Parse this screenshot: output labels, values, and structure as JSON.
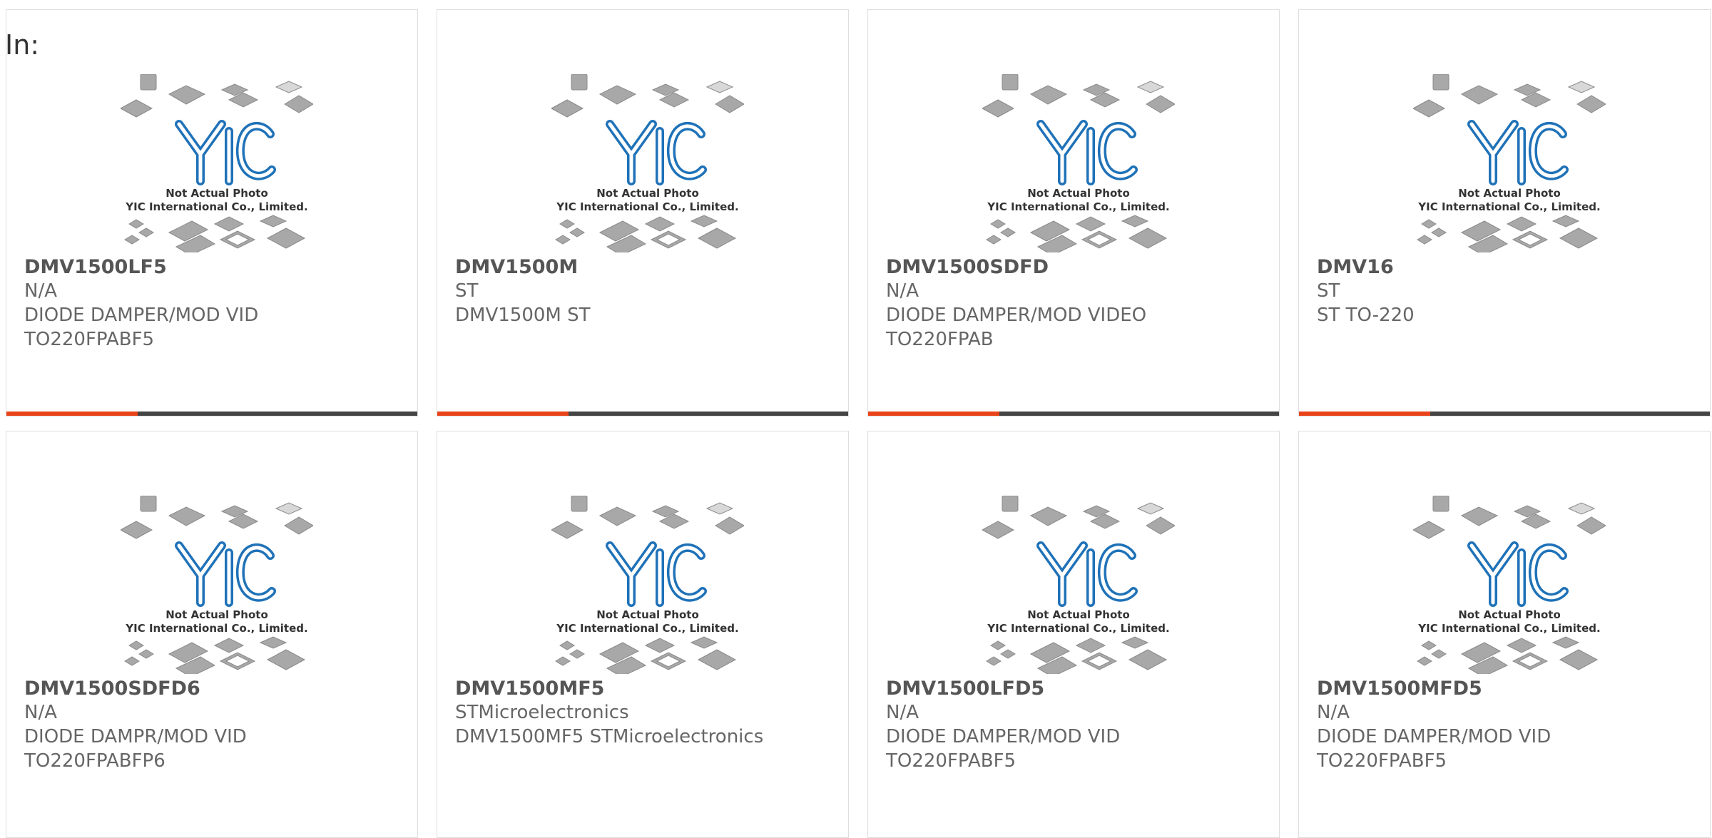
{
  "search": {
    "label": "In:"
  },
  "placeholder_image": {
    "caption_line1": "Not Actual Photo",
    "caption_line2": "YIC International Co., Limited.",
    "logo_text": "YIC"
  },
  "colors": {
    "accent": "#e8431a",
    "bar": "#444444",
    "logo_blue": "#1f72b8",
    "chip_gray": "#a8a8a8"
  },
  "products": [
    {
      "part": "DMV1500LF5",
      "mfr": "N/A",
      "desc1": "DIODE DAMPER/MOD VID",
      "desc2": "TO220FPABF5"
    },
    {
      "part": "DMV1500M",
      "mfr": "ST",
      "desc1": "DMV1500M ST",
      "desc2": ""
    },
    {
      "part": "DMV1500SDFD",
      "mfr": "N/A",
      "desc1": "DIODE DAMPER/MOD VIDEO",
      "desc2": "TO220FPAB"
    },
    {
      "part": "DMV16",
      "mfr": "ST",
      "desc1": "ST TO-220",
      "desc2": ""
    },
    {
      "part": "DMV1500SDFD6",
      "mfr": "N/A",
      "desc1": "DIODE DAMPR/MOD VID",
      "desc2": "TO220FPABFP6"
    },
    {
      "part": "DMV1500MF5",
      "mfr": "STMicroelectronics",
      "desc1": "DMV1500MF5 STMicroelectronics",
      "desc2": ""
    },
    {
      "part": "DMV1500LFD5",
      "mfr": "N/A",
      "desc1": "DIODE DAMPER/MOD VID",
      "desc2": "TO220FPABF5"
    },
    {
      "part": "DMV1500MFD5",
      "mfr": "N/A",
      "desc1": "DIODE DAMPER/MOD VID",
      "desc2": "TO220FPABF5"
    }
  ]
}
